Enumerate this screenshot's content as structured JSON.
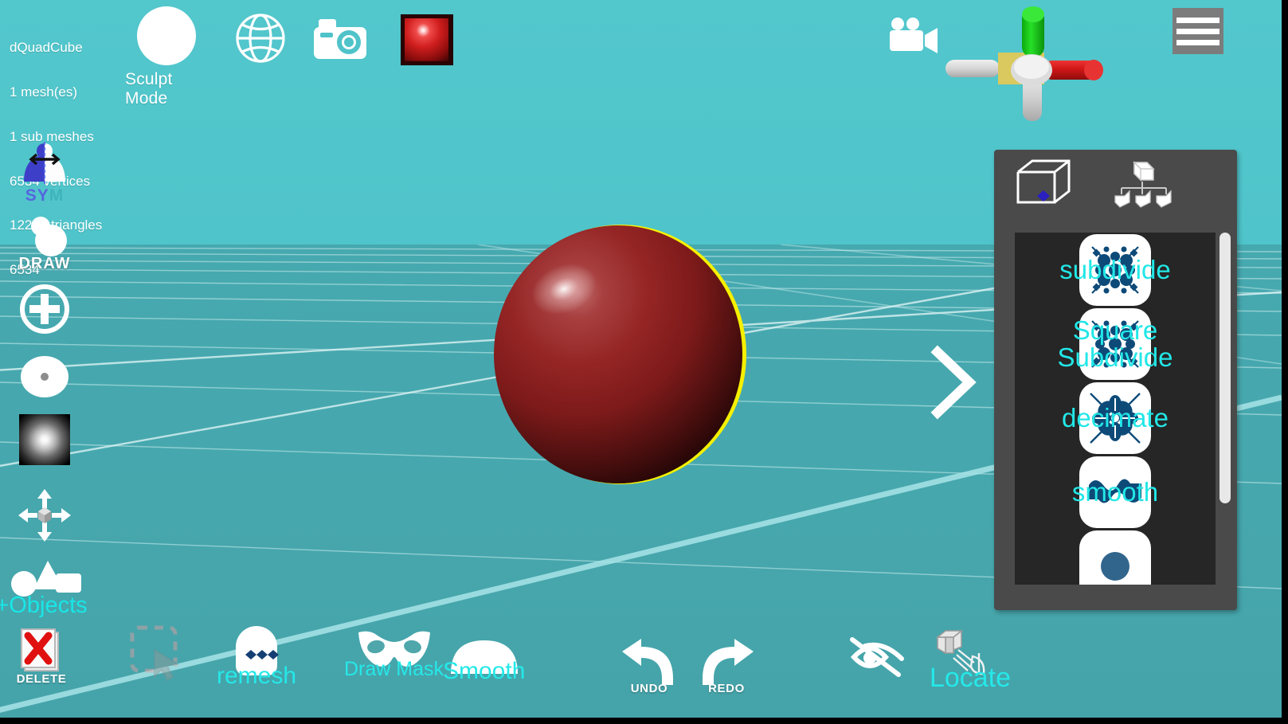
{
  "mesh_info": {
    "name": "dQuadCube",
    "meshes": "1 mesh(es)",
    "sub_meshes": "1 sub meshes",
    "vertices": "6534 vertices",
    "triangles": "12288 triangles",
    "extra": "6534"
  },
  "top_toolbar": {
    "sculpt_mode_label": "Sculpt Mode",
    "sculpt_mode_icon": "white-circle-icon",
    "globe_icon": "globe-icon",
    "camera_icon": "camera-icon",
    "material_icon": "red-sphere-material-thumbnail",
    "video_icon": "video-camera-icon",
    "menu_icon": "hamburger-menu-icon"
  },
  "gizmo": {
    "axis_y_color": "#16c516",
    "axis_x_color": "#d61f1f",
    "axis_center_color": "#d6c45a",
    "axis_neutral_color": "#d4d4d4"
  },
  "left_toolbar": {
    "sym": {
      "label_part1": "SY",
      "label_part2": "M",
      "icon": "symmetry-icon"
    },
    "draw": {
      "label": "DRAW",
      "icon": "draw-blob-icon"
    },
    "add": {
      "label": "",
      "icon": "plus-circle-icon"
    },
    "radius": {
      "label": "",
      "icon": "brush-radius-icon"
    },
    "falloff": {
      "label": "",
      "icon": "falloff-gradient-swatch"
    },
    "move": {
      "label": "",
      "icon": "move-arrows-icon"
    },
    "objects": {
      "label": "+Objects",
      "icon": "primitive-shapes-icon"
    }
  },
  "viewport": {
    "next_chevron": "chevron-right-icon",
    "sky_color": "#52c7cc",
    "ground_color": "#46a8ae",
    "grid_color": "#b8e9ec",
    "model_color": "#9e2525",
    "selection_outline_color": "#f5f000"
  },
  "right_panel": {
    "tabs": [
      {
        "name": "wireframe-cube-tab",
        "icon": "wireframe-cube-icon"
      },
      {
        "name": "scene-hierarchy-tab",
        "icon": "hierarchy-tree-icon"
      }
    ],
    "items": [
      {
        "label": "subdivide",
        "icon": "subdivide-icon"
      },
      {
        "label": "Square\nSubdivide",
        "icon": "square-subdivide-icon"
      },
      {
        "label": "decimate",
        "icon": "decimate-icon"
      },
      {
        "label": "smooth",
        "icon": "smooth-wave-icon"
      },
      {
        "label": "",
        "icon": "partial-item-icon"
      }
    ],
    "accent_color": "#22e7e7",
    "panel_bg": "#4a4a4a",
    "list_bg": "#262626"
  },
  "bottom_toolbar": {
    "delete": {
      "label": "DELETE",
      "icon": "delete-x-icon"
    },
    "select": {
      "label": "",
      "icon": "box-select-cursor-icon"
    },
    "remesh": {
      "label": "remesh",
      "icon": "remesh-icon"
    },
    "draw_mask": {
      "label": "Draw Mask",
      "icon": "mask-icon"
    },
    "smooth": {
      "label": "Smooth",
      "icon": "smooth-dome-icon"
    },
    "undo": {
      "label": "UNDO",
      "icon": "undo-arrow-icon"
    },
    "redo": {
      "label": "REDO",
      "icon": "redo-arrow-icon"
    },
    "hide": {
      "label": "",
      "icon": "eye-slash-icon"
    },
    "locate": {
      "label": "Locate",
      "icon": "locate-cube-icon"
    }
  }
}
